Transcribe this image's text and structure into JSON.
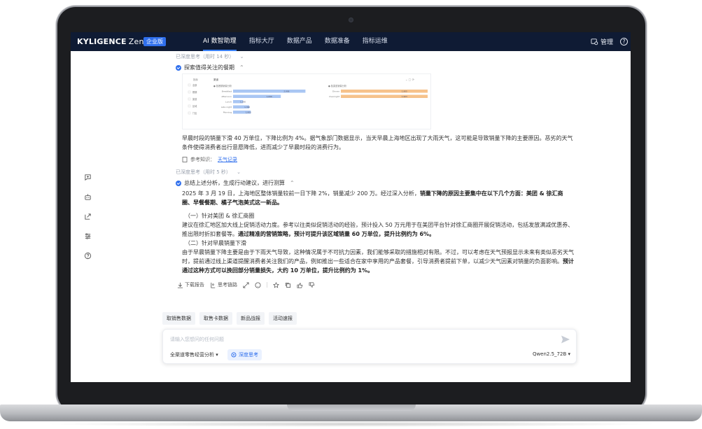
{
  "app": {
    "logo_brand": "KYLIGENCE",
    "logo_product": "Zen",
    "edition_badge": "企业版",
    "nav": [
      "AI 数智助理",
      "指标大厅",
      "数据产品",
      "数据准备",
      "指标运维"
    ],
    "active_nav_index": 0,
    "right": {
      "admin_label": "管理",
      "help_glyph": "?"
    }
  },
  "rail_icons": [
    "new-chat-icon",
    "bot-icon",
    "share-icon",
    "settings-sliders-icon",
    "help-icon"
  ],
  "thinking1": {
    "meta": "已深度思考（用时 14 秒）",
    "expand": "⌄",
    "step_title": "探索值得关注的餐期",
    "caret": "⌃"
  },
  "mini_chart": {
    "filters": [
      "指标",
      "渠道"
    ],
    "checks": [
      "全部",
      "餐期",
      "渠道",
      "区域",
      "门店"
    ],
    "left_title": "● 各餐期销量分析",
    "right_title": "● 各渠道销量分析"
  },
  "finding": "早晨时段的销量下滑 40 万单位，下降比例为 4%。据气象部门数据显示，当天早晨上海地区出现了大雨天气，这可能是导致销量下降的主要原因。恶劣的天气条件使得消费者出行意愿降低，进而减少了早晨时段的消费行为。",
  "reference": {
    "label": "参考知识：",
    "link": "天气记录"
  },
  "thinking2": {
    "meta": "已深度思考（用时 5 秒）",
    "expand": "⌄",
    "step_title": "总结上述分析，生成行动建议，进行测算",
    "caret": "⌃"
  },
  "summary": {
    "intro": "2025 年 3 月 19 日，上海地区整体销量较前一日下降 2%，销量减少 200 万。经过深入分析，",
    "intro_bold": "销量下降的原因主要集中在以下几个方面：美团 & 徐汇商圈、早餐餐期、橘子气泡美式这一新品。",
    "s1_title": "（一）针对美团 & 徐汇商圈",
    "s1_body": "建议在徐汇地区加大线上促销活动力度。参考以往类似促销活动的经验，预计投入 50 万元用于在美团平台针对徐汇商圈开展促销活动，包括发放满减优惠券、推出限时折扣套餐等。",
    "s1_bold": "通过精准的营销策略，预计可提升该区域销量 60 万单位，提升比例约为 6%。",
    "s2_title": "（二）针对早晨销量下滑",
    "s2_body": "由于早晨销量下降主要是由于下雨天气导致，这种情况属于不可抗力因素，我们能够采取的措施相对有限。不过，可以考虑在天气预报显示未来有类似恶劣天气时，提前通过线上渠道提醒消费者关注我们的产品，例如推出一些适合在家中享用的产品套餐，引导消费者提前下单，以减少天气因素对销量的负面影响。",
    "s2_bold": "预计通过这种方式可以挽回部分销量损失，大约 10 万单位，提升比例约为 1%。"
  },
  "actions": {
    "download": "下载报告",
    "chain": "思考链路"
  },
  "quick_chips": [
    "取销售数据",
    "取售卡数据",
    "新品战报",
    "活动速报"
  ],
  "composer": {
    "placeholder": "请输入您想问的任何问题",
    "scope": "全渠道零售经营分析 ▾",
    "deep_think": "深度思考",
    "model": "Qwen2.5_72B ▾"
  },
  "chart_data": [
    {
      "type": "bar",
      "title": "各餐期销量分析",
      "categories": [
        "Breakfast",
        "Afternoon",
        "Lunch",
        "Late night",
        "Morning"
      ],
      "values": [
        0.94,
        0.62,
        0.13,
        0.21,
        0.23
      ],
      "value_labels": [
        "2,906",
        "1,696",
        "1,390",
        "1,396",
        "1,900"
      ]
    },
    {
      "type": "bar",
      "title": "各渠道销量分析",
      "categories": [
        "Dinner",
        "Overnight"
      ],
      "values": [
        1.0,
        1.0
      ],
      "value_labels": [
        "1,905",
        "1,903"
      ]
    }
  ],
  "colors": {
    "nav_bg": "#0f1b34",
    "accent": "#2f6fed",
    "bar_blue": "#a9c6f3",
    "bar_orange": "#f6c28b"
  }
}
